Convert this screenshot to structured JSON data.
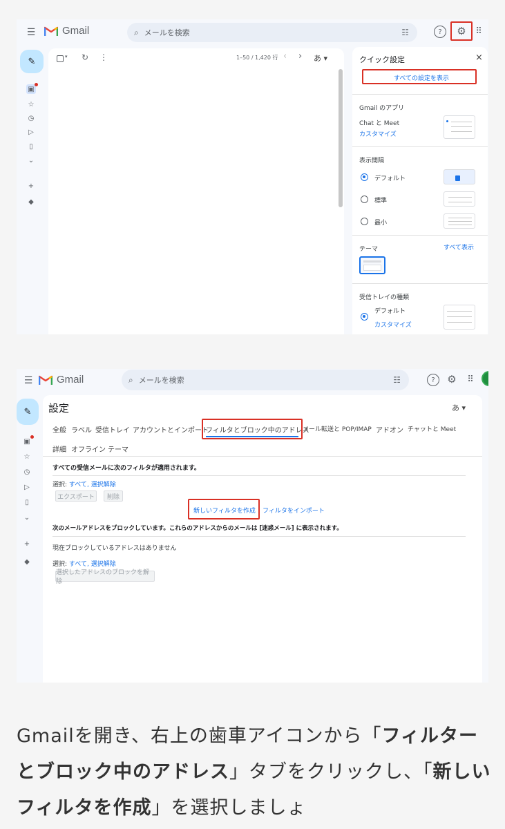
{
  "screenshot1": {
    "app_name": "Gmail",
    "search_placeholder": "メールを検索",
    "pagination": "1–50 / 1,420 行",
    "lang_selector": "あ ▾",
    "quick_settings": {
      "title": "クイック設定",
      "close": "×",
      "show_all_settings": "すべての設定を表示",
      "apps_heading": "Gmail のアプリ",
      "chat_meet": "Chat と Meet",
      "customize": "カスタマイズ",
      "density_heading": "表示間隔",
      "density_options": [
        "デフォルト",
        "標準",
        "最小"
      ],
      "theme_heading": "テーマ",
      "theme_show_all": "すべて表示",
      "inbox_type_heading": "受信トレイの種類",
      "inbox_default": "デフォルト",
      "inbox_customize": "カスタマイズ"
    }
  },
  "screenshot2": {
    "app_name": "Gmail",
    "search_placeholder": "メールを検索",
    "settings_title": "設定",
    "lang_selector": "あ ▾",
    "tabs_row1": [
      "全般",
      "ラベル",
      "受信トレイ",
      "アカウントとインポート",
      "フィルタとブロック中のアドレス",
      "メール転送と POP/IMAP",
      "アドオン",
      "チャットと Meet"
    ],
    "tabs_row2": [
      "詳細",
      "オフライン",
      "テーマ"
    ],
    "filters_heading": "すべての受信メールに次のフィルタが適用されます。",
    "select_label": "選択:",
    "select_all": "すべて",
    "select_none": "選択解除",
    "export_button": "エクスポート",
    "delete_button": "削除",
    "create_filter": "新しいフィルタを作成",
    "import_filters": "フィルタをインポート",
    "blocked_heading": "次のメールアドレスをブロックしています。これらのアドレスからのメールは [迷惑メール] に表示されます。",
    "no_blocked": "現在ブロックしているアドレスはありません",
    "unblock_button": "選択したアドレスのブロックを解除"
  },
  "caption": {
    "part1": "Gmailを開き、右上の歯車アイコンから「",
    "bold1": "フィルターとブロック中のアドレス",
    "part2": "」タブをクリックし、「",
    "bold2": "新しいフィルタを作成",
    "part3": "」を選択しましょ"
  },
  "colors": {
    "accent_blue": "#1a73e8",
    "highlight_red": "#d93025",
    "compose_bg": "#c2e7ff",
    "gmail_bg": "#f6f8fc"
  }
}
